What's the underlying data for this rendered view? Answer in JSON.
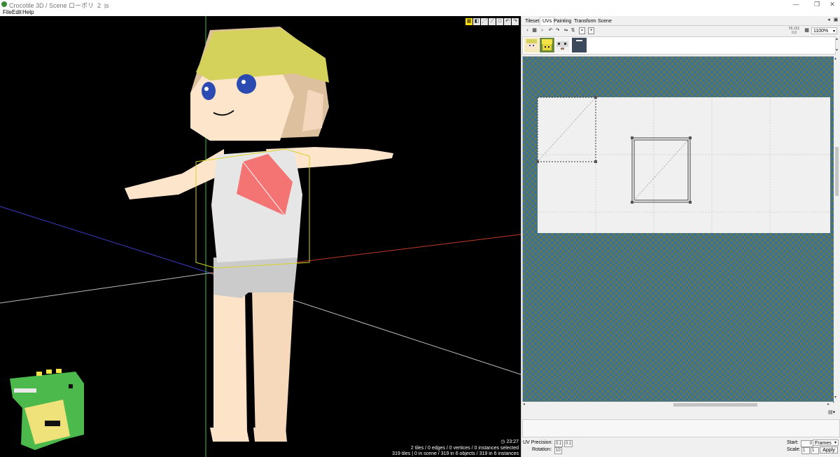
{
  "window": {
    "title": "Crocotile 3D / Scene ローポリ_2_js",
    "controls": [
      "—",
      "❐",
      "✕"
    ]
  },
  "menu": [
    "File",
    "Edit",
    "Help"
  ],
  "viewport": {
    "toolbar_icons": [
      "tile-select-icon",
      "cube-icon",
      "vertex-icon",
      "edge-icon",
      "square-icon",
      "undo-icon",
      "redo-icon"
    ],
    "status": {
      "time": "23:27",
      "selection": "2 tiles / 0 edges / 0 vertices / 0 instances selected",
      "scene": "319 tiles | 0 in scene / 319 in 6 objects / 319 in 6 instances"
    }
  },
  "sidepanel": {
    "tabs": [
      "Tileset",
      "UVs",
      "Painting",
      "Transform",
      "Scene"
    ],
    "active_tab": "UVs",
    "uv_toolbar": {
      "coords_top": "55,151",
      "coords_bottom": "0,0",
      "zoom": "1100%"
    },
    "uv_props": {
      "precision_label": "UV Precision:",
      "precision_x": "0.1",
      "precision_y": "0.1",
      "rotation_label": "Rotation:",
      "rotation_value": "10"
    },
    "anim": {
      "start_label": "Start:",
      "start_value": "0",
      "unit": "Frames",
      "scale_label": "Scale:",
      "scale_x": "1",
      "scale_y": "1",
      "apply_label": "Apply"
    }
  },
  "colors": {
    "viewport_bg": "#000000",
    "hair": "#d4d25a",
    "skin": "#fde5cc",
    "selected_face": "#f47474",
    "shirt": "#e4e4e4",
    "shorts": "#c9c9c9",
    "gizmo_yellow": "#d6d224",
    "dino_green": "#4cb94c"
  }
}
